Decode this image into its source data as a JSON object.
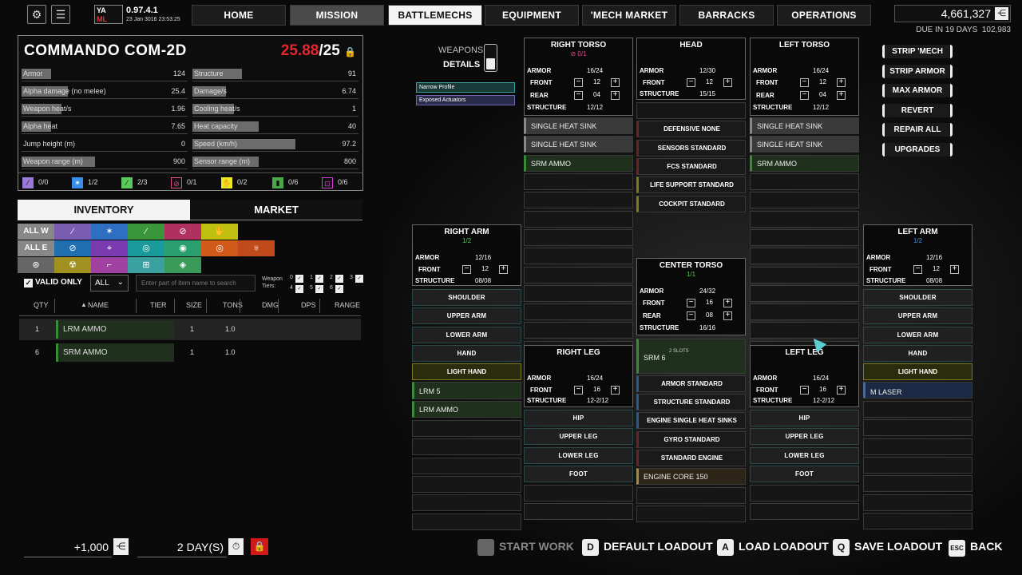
{
  "topbar": {
    "version": "0.97.4.1",
    "date": "23 Jan 3016 23:53:25",
    "tabs": [
      "HOME",
      "MISSION",
      "BATTLEMECHS",
      "EQUIPMENT",
      "'MECH MARKET",
      "BARRACKS",
      "OPERATIONS"
    ],
    "funds": "4,661,327",
    "due_label": "DUE IN 19 DAYS",
    "due_amount": "102,983"
  },
  "mech": {
    "name": "COMMANDO  COM-2D",
    "tonnage_current": "25.88",
    "tonnage_max": "/25",
    "stats_left": [
      {
        "label": "Armor",
        "value": "124",
        "fill": 0.18
      },
      {
        "label": "Alpha damage (no melee)",
        "value": "25.4",
        "fill": 0.28
      },
      {
        "label": "Weapon heat/s",
        "value": "1.96",
        "fill": 0.24
      },
      {
        "label": "Alpha heat",
        "value": "7.65",
        "fill": 0.18
      },
      {
        "label": "Jump height (m)",
        "value": "0",
        "fill": 0
      },
      {
        "label": "Weapon range (m)",
        "value": "900",
        "fill": 0.44
      }
    ],
    "stats_right": [
      {
        "label": "Structure",
        "value": "91",
        "fill": 0.3
      },
      {
        "label": "Damage/s",
        "value": "6.74",
        "fill": 0.2
      },
      {
        "label": "Cooling heat/s",
        "value": "1",
        "fill": 0.25
      },
      {
        "label": "Heat capacity",
        "value": "40",
        "fill": 0.4
      },
      {
        "label": "Speed (km/h)",
        "value": "97.2",
        "fill": 0.62
      },
      {
        "label": "Sensor range (m)",
        "value": "800",
        "fill": 0.4
      }
    ],
    "hardpoints": [
      "0/0",
      "1/2",
      "2/3",
      "0/1",
      "0/2",
      "0/6",
      "0/6"
    ]
  },
  "inventory": {
    "tab_inventory": "INVENTORY",
    "tab_market": "MARKET",
    "all_w": "ALL W",
    "all_e": "ALL E",
    "valid_only": "VALID ONLY",
    "select_value": "ALL",
    "search_placeholder": "Enter part of item name to search",
    "weapon_tiers_label": "Weapon Tiers:",
    "tier_nums": [
      "0",
      "1",
      "2",
      "3",
      "4",
      "5",
      "6"
    ],
    "headers": [
      "QTY",
      "NAME",
      "TIER",
      "SIZE",
      "TONS",
      "DMG",
      "DPS",
      "RANGE"
    ],
    "rows": [
      {
        "qty": "1",
        "name": "LRM AMMO",
        "size": "1",
        "tons": "1.0"
      },
      {
        "qty": "6",
        "name": "SRM AMMO",
        "size": "1",
        "tons": "1.0"
      }
    ]
  },
  "toggle": {
    "weapons": "WEAPONS",
    "details": "DETAILS"
  },
  "quirks": [
    "Narrow Profile",
    "Exposed Actuators"
  ],
  "locations": {
    "right_torso": {
      "title": "RIGHT TORSO",
      "sub": "⊘ 0/1",
      "armor": "16/24",
      "front": "12",
      "rear": "04",
      "structure": "12/12",
      "slots": [
        "SINGLE HEAT SINK",
        "SINGLE HEAT SINK",
        "SRM AMMO"
      ]
    },
    "head": {
      "title": "HEAD",
      "armor": "12/30",
      "front": "12",
      "structure": "15/15",
      "slots": [
        "DEFENSIVE NONE",
        "SENSORS STANDARD",
        "FCS STANDARD",
        "LIFE SUPPORT STANDARD",
        "COCKPIT STANDARD"
      ]
    },
    "left_torso": {
      "title": "LEFT TORSO",
      "armor": "16/24",
      "front": "12",
      "rear": "04",
      "structure": "12/12",
      "slots": [
        "SINGLE HEAT SINK",
        "SINGLE HEAT SINK",
        "SRM AMMO"
      ]
    },
    "right_arm": {
      "title": "RIGHT ARM",
      "sub": "1/2",
      "armor": "12/16",
      "front": "12",
      "structure": "08/08",
      "slots": [
        "SHOULDER",
        "UPPER ARM",
        "LOWER ARM",
        "HAND",
        "LIGHT HAND",
        "LRM 5",
        "LRM AMMO"
      ]
    },
    "center_torso": {
      "title": "CENTER TORSO",
      "sub": "1/1",
      "armor": "24/32",
      "front": "16",
      "rear": "08",
      "structure": "16/16",
      "srm": "SRM 6",
      "srm_slots": "2 SLOTS",
      "slots": [
        "ARMOR STANDARD",
        "STRUCTURE STANDARD",
        "ENGINE SINGLE HEAT SINKS",
        "GYRO STANDARD",
        "STANDARD ENGINE",
        "ENGINE CORE 150"
      ]
    },
    "right_leg": {
      "title": "RIGHT LEG",
      "armor": "16/24",
      "front": "16",
      "structure": "12-2/12",
      "slots": [
        "HIP",
        "UPPER LEG",
        "LOWER LEG",
        "FOOT"
      ]
    },
    "left_leg": {
      "title": "LEFT LEG",
      "armor": "16/24",
      "front": "16",
      "structure": "12-2/12",
      "slots": [
        "HIP",
        "UPPER LEG",
        "LOWER LEG",
        "FOOT"
      ]
    },
    "left_arm": {
      "title": "LEFT ARM",
      "sub": "1/2",
      "armor": "12/16",
      "front": "12",
      "structure": "08/08",
      "slots": [
        "SHOULDER",
        "UPPER ARM",
        "LOWER ARM",
        "HAND",
        "LIGHT HAND",
        "M LASER"
      ]
    }
  },
  "labels": {
    "armor": "ARMOR",
    "front": "FRONT",
    "rear": "REAR",
    "structure": "STRUCTURE"
  },
  "right_buttons": [
    "STRIP 'MECH",
    "STRIP ARMOR",
    "MAX ARMOR",
    "REVERT",
    "REPAIR ALL",
    "UPGRADES"
  ],
  "bottom": {
    "cost": "+1,000",
    "days": "2 DAY(S)",
    "actions": [
      {
        "key": "",
        "label": "START WORK"
      },
      {
        "key": "D",
        "label": "DEFAULT LOADOUT"
      },
      {
        "key": "A",
        "label": "LOAD LOADOUT"
      },
      {
        "key": "Q",
        "label": "SAVE LOADOUT"
      },
      {
        "key": "ESC",
        "label": "BACK"
      }
    ]
  }
}
